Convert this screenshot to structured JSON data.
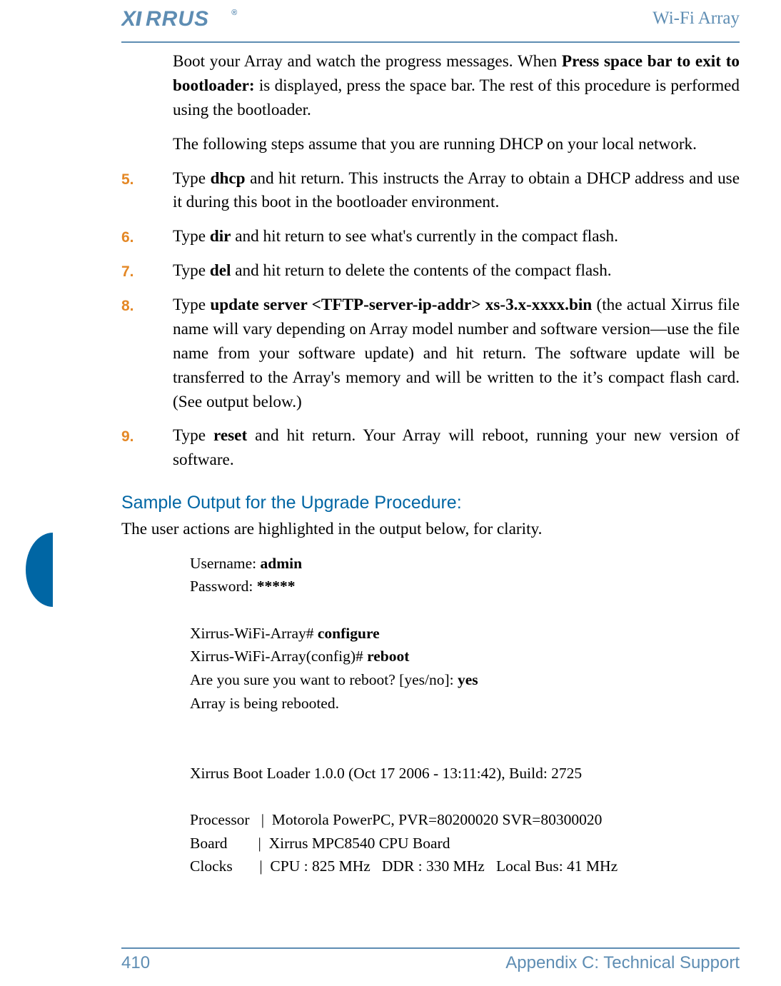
{
  "header": {
    "logo_text": "XIRRUS",
    "right": "Wi-Fi Array"
  },
  "intro": {
    "p1_pre": "Boot your Array and watch the progress messages. When ",
    "p1_bold": "Press space bar to exit to bootloader:",
    "p1_post": " is displayed, press the space bar. The rest of this procedure is performed using the bootloader.",
    "p2": "The following steps assume that you are running DHCP on your local network."
  },
  "steps": [
    {
      "num": "5.",
      "pre": "Type ",
      "bold": "dhcp",
      "post": " and hit return. This instructs the Array to obtain a DHCP address and use it during this boot in the bootloader environment."
    },
    {
      "num": "6.",
      "pre": "Type ",
      "bold": "dir",
      "post": " and hit return to see what's currently in the compact flash."
    },
    {
      "num": "7.",
      "pre": "Type ",
      "bold": "del",
      "post": " and hit return to delete the contents of the compact flash."
    },
    {
      "num": "8.",
      "pre": "Type ",
      "bold": "update server <TFTP-server-ip-addr> xs-3.x-xxxx.bin",
      "post": " (the actual Xirrus file name will vary depending on Array model number and software version—use the file name from your software update) and hit return. The software update will be transferred to the Array's memory and will be written to the it’s compact flash card. (See output below.)"
    },
    {
      "num": "9.",
      "pre": "Type ",
      "bold": "reset",
      "post": " and hit return. Your Array will reboot, running your new version of software."
    }
  ],
  "section_head": "Sample Output for the Upgrade Procedure:",
  "section_sub": "The user actions are highlighted in the output below, for clarity.",
  "output": {
    "l1a": "Username: ",
    "l1b": "admin",
    "l2a": "Password: ",
    "l2b": "*****",
    "l3a": "Xirrus-WiFi-Array# ",
    "l3b": "configure",
    "l4a": "Xirrus-WiFi-Array(config)# ",
    "l4b": "reboot",
    "l5a": "Are you sure you want to reboot? [yes/no]: ",
    "l5b": "yes",
    "l6": "Array is being rebooted.",
    "l7": "Xirrus Boot Loader 1.0.0 (Oct 17 2006 - 13:11:42), Build: 2725",
    "l8": "Processor   |  Motorola PowerPC, PVR=80200020 SVR=80300020",
    "l9": "Board        |  Xirrus MPC8540 CPU Board",
    "l10": "Clocks       |  CPU : 825 MHz   DDR : 330 MHz   Local Bus: 41 MHz"
  },
  "footer": {
    "page": "410",
    "section": "Appendix C: Technical Support"
  }
}
